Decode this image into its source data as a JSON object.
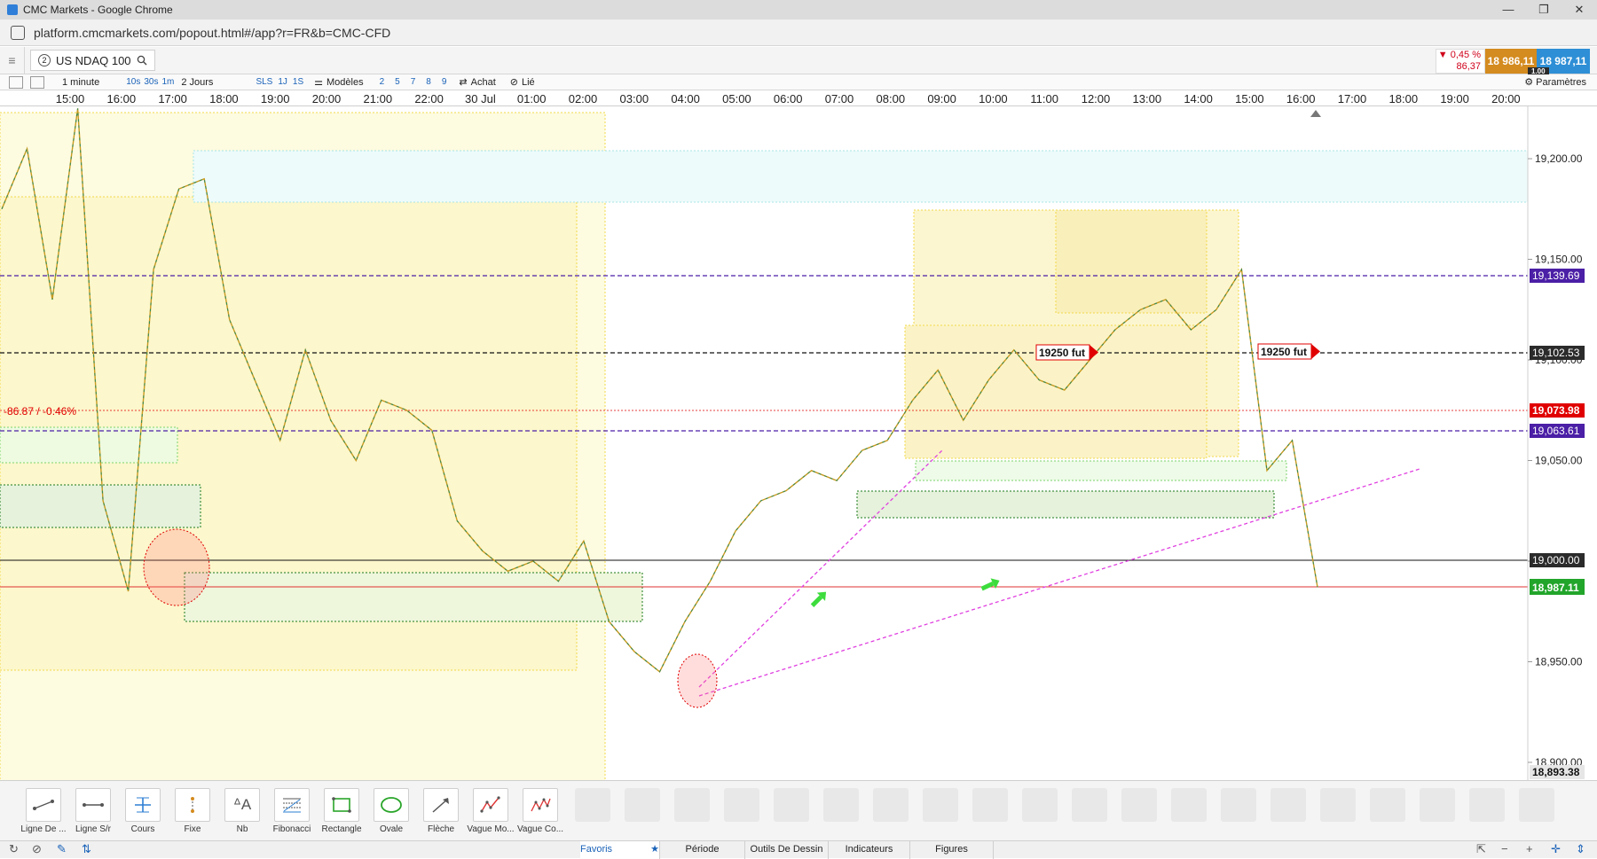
{
  "window": {
    "title": "CMC Markets - Google Chrome",
    "controls": [
      "—",
      "❐",
      "✕"
    ]
  },
  "browser": {
    "url": "platform.cmcmarkets.com/popout.html#/app?r=FR&b=CMC-CFD"
  },
  "instrument": {
    "tab_number": "2",
    "name": "US NDAQ 100"
  },
  "quote": {
    "change_pct": "▼ 0,45 %",
    "change_abs": "86,37",
    "sell": "18 986,11",
    "buy": "18 987,11",
    "spread": "1.00"
  },
  "toolbar": {
    "timeframe": "1 minute",
    "quick_intervals": [
      "10s",
      "30s",
      "1m"
    ],
    "range": "2 Jours",
    "sls": "SLS",
    "r1j": "1J",
    "r1s": "1S",
    "models": "Modèles",
    "counts": [
      "2",
      "5",
      "7",
      "8",
      "9"
    ],
    "buy": "Achat",
    "linked": "Lié",
    "settings": "Paramètres"
  },
  "time_axis": [
    "15:00",
    "16:00",
    "17:00",
    "18:00",
    "19:00",
    "20:00",
    "21:00",
    "22:00",
    "30 Jul",
    "01:00",
    "02:00",
    "03:00",
    "04:00",
    "05:00",
    "06:00",
    "07:00",
    "08:00",
    "09:00",
    "10:00",
    "11:00",
    "12:00",
    "13:00",
    "14:00",
    "15:00",
    "16:00",
    "17:00",
    "18:00",
    "19:00",
    "20:00"
  ],
  "price_axis": [
    "19,200.00",
    "19,150.00",
    "19,100.00",
    "19,050.00",
    "19,000.00",
    "18,950.00",
    "18,900.00"
  ],
  "price_labels": {
    "level_purple_top": "19,139.69",
    "level_black_dashed": "19,102.53",
    "prev_close": "19,073.98",
    "level_purple_low": "19,063.61",
    "round_level": "19,000.00",
    "current": "18,987.11",
    "bottom": "18,893.38"
  },
  "chart_labels": {
    "change": "-86.87 / -0.46%",
    "fut_tag_1": "19250 fut",
    "fut_tag_2": "19250 fut"
  },
  "colors": {
    "up": "#2e8b57",
    "down": "#d4a017",
    "purple": "#4b1fa6",
    "red": "#e00000",
    "green_price": "#22a52b",
    "magenta_trend": "#e040e0"
  },
  "chart_data": {
    "type": "line",
    "x_label": "",
    "y_label": "",
    "ylim": [
      18893.38,
      19226
    ],
    "x": [
      "15:00",
      "15:30",
      "16:00",
      "16:30",
      "17:00",
      "17:30",
      "18:00",
      "18:30",
      "19:00",
      "19:30",
      "20:00",
      "20:30",
      "21:00",
      "21:30",
      "22:00",
      "22:30",
      "23:00",
      "23:30",
      "00:00",
      "00:30",
      "01:00",
      "01:30",
      "02:00",
      "02:30",
      "03:00",
      "03:30",
      "04:00",
      "04:30",
      "05:00",
      "05:30",
      "06:00",
      "06:30",
      "07:00",
      "07:30",
      "08:00",
      "08:30",
      "09:00",
      "09:30",
      "10:00",
      "10:30",
      "11:00",
      "11:30",
      "12:00",
      "12:30",
      "13:00",
      "13:30",
      "14:00",
      "14:30",
      "15:00",
      "15:20",
      "15:40",
      "16:00",
      "16:15"
    ],
    "series": [
      {
        "values": [
          19175,
          19205,
          19130,
          19225,
          19030,
          18985,
          19145,
          19185,
          19190,
          19120,
          19090,
          19060,
          19105,
          19070,
          19050,
          19080,
          19075,
          19065,
          19020,
          19005,
          18995,
          19000,
          18990,
          19010,
          18970,
          18955,
          18945,
          18970,
          18990,
          19015,
          19030,
          19035,
          19045,
          19040,
          19055,
          19060,
          19080,
          19095,
          19070,
          19090,
          19105,
          19090,
          19085,
          19100,
          19115,
          19125,
          19130,
          19115,
          19125,
          19145,
          19045,
          19060,
          18987
        ]
      }
    ],
    "horizontal_lines": [
      19139.69,
      19102.53,
      19073.98,
      19063.61,
      19000.0,
      18987.11
    ]
  },
  "drawing_tools": [
    {
      "name": "line-tool",
      "label": "Ligne De ..."
    },
    {
      "name": "sr-line-tool",
      "label": "Ligne S/r"
    },
    {
      "name": "price-tool",
      "label": "Cours"
    },
    {
      "name": "fixed-tool",
      "label": "Fixe"
    },
    {
      "name": "text-tool",
      "label": "Nb"
    },
    {
      "name": "fibonacci-tool",
      "label": "Fibonacci"
    },
    {
      "name": "rectangle-tool",
      "label": "Rectangle"
    },
    {
      "name": "oval-tool",
      "label": "Ovale"
    },
    {
      "name": "arrow-tool",
      "label": "Flèche"
    },
    {
      "name": "wave-motive-tool",
      "label": "Vague Mo..."
    },
    {
      "name": "wave-corrective-tool",
      "label": "Vague Co..."
    }
  ],
  "bottom_tabs": [
    "Favoris",
    "Période",
    "Outils De Dessin",
    "Indicateurs",
    "Figures"
  ]
}
